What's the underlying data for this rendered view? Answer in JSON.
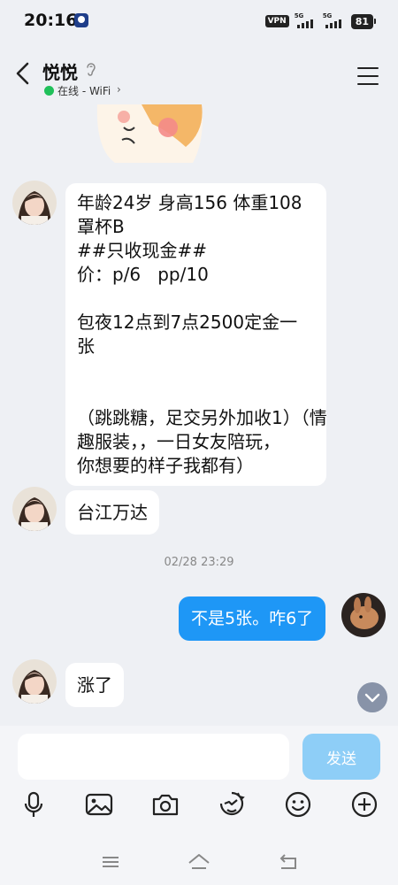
{
  "status_bar": {
    "time": "20:16",
    "vpn": "VPN",
    "net1": "5G",
    "net2": "5G",
    "battery": "81"
  },
  "header": {
    "contact_name": "悦悦",
    "status": "在线 - WiFi",
    "status_chevron": "›",
    "online_color": "#20c05a"
  },
  "messages": [
    {
      "direction": "incoming",
      "lines": [
        "年龄24岁 身高156 体重108",
        "罩杯B",
        "##只收现金##",
        "价：p/6   pp/10",
        "",
        "包夜12点到7点2500定金一",
        "张",
        "",
        "",
        "（跳跳糖，足交另外加收1）（情",
        "趣服装，，一日女友陪玩，",
        "你想要的样子我都有）"
      ]
    },
    {
      "direction": "incoming",
      "text": "台江万达"
    },
    {
      "direction": "outgoing",
      "text": "不是5张。咋6了"
    },
    {
      "direction": "incoming",
      "text": "涨了"
    }
  ],
  "timestamp": "02/28 23:29",
  "composer": {
    "placeholder": "",
    "send_label": "发送",
    "send_color": "#8ecef7"
  },
  "toolbar_icons": [
    "microphone-icon",
    "image-icon",
    "camera-icon",
    "sticker-icon",
    "emoji-icon",
    "plus-icon"
  ],
  "nav_icons": [
    "menu-nav-icon",
    "home-nav-icon",
    "back-nav-icon"
  ],
  "colors": {
    "outgoing_bubble": "#1e97f6",
    "background": "#eef0f4"
  }
}
